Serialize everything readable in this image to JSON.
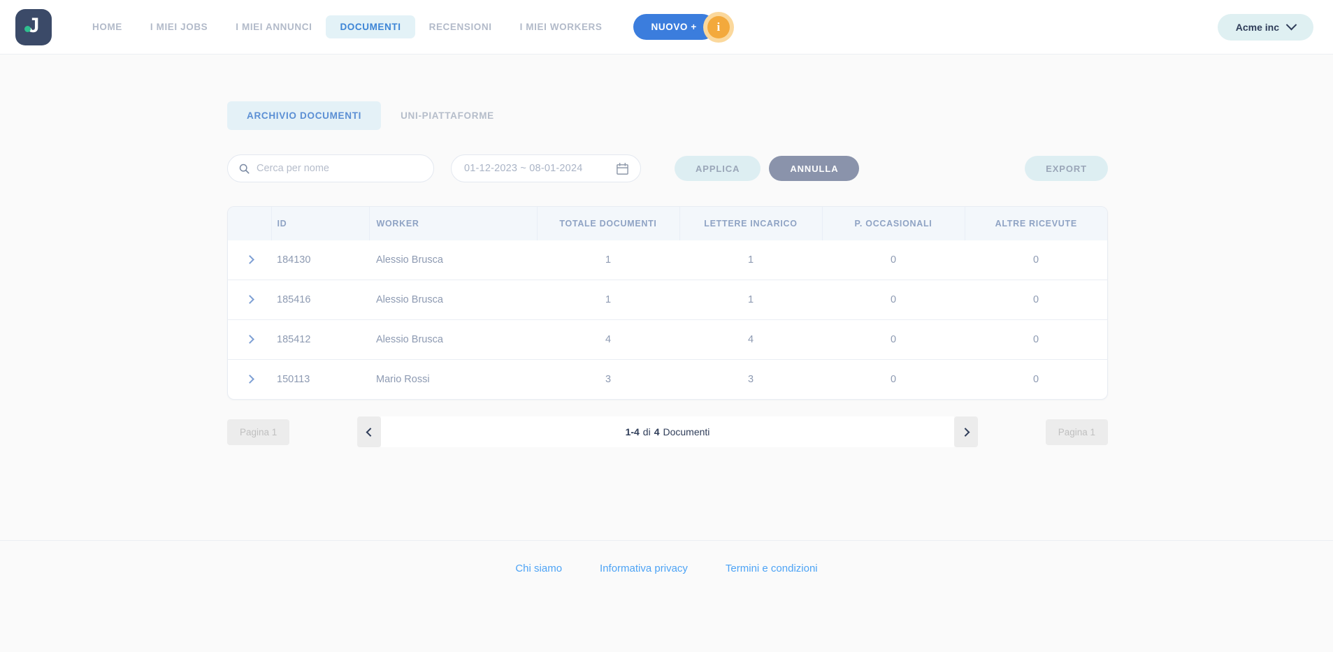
{
  "header": {
    "logo": {
      "letter": "J",
      "icon": "logo-j-mark"
    },
    "nav": [
      {
        "label": "HOME",
        "active": false
      },
      {
        "label": "I MIEI JOBS",
        "active": false
      },
      {
        "label": "I MIEI ANNUNCI",
        "active": false
      },
      {
        "label": "DOCUMENTI",
        "active": true
      },
      {
        "label": "RECENSIONI",
        "active": false
      },
      {
        "label": "I MIEI WORKERS",
        "active": false
      }
    ],
    "new_button": "NUOVO +",
    "info_badge": "i",
    "org": "Acme inc",
    "colors": {
      "accent_blue": "#3b7ddd",
      "active_tab_bg": "#e3f2f7",
      "badge_orange": "#f3a93c"
    }
  },
  "tabs": [
    {
      "label": "ARCHIVIO DOCUMENTI",
      "active": true
    },
    {
      "label": "UNI-PIATTAFORME",
      "active": false
    }
  ],
  "toolbar": {
    "search_placeholder": "Cerca per nome",
    "search_value": "",
    "date_range": "01-12-2023 ~ 08-01-2024",
    "apply_label": "APPLICA",
    "cancel_label": "ANNULLA",
    "export_label": "EXPORT"
  },
  "table": {
    "columns": [
      "ID",
      "WORKER",
      "TOTALE DOCUMENTI",
      "LETTERE INCARICO",
      "P. OCCASIONALI",
      "ALTRE RICEVUTE"
    ],
    "rows": [
      {
        "id": "184130",
        "worker": "Alessio Brusca",
        "totale_documenti": "1",
        "lettere_incarico": "1",
        "p_occasionali": "0",
        "altre_ricevute": "0"
      },
      {
        "id": "185416",
        "worker": "Alessio Brusca",
        "totale_documenti": "1",
        "lettere_incarico": "1",
        "p_occasionali": "0",
        "altre_ricevute": "0"
      },
      {
        "id": "185412",
        "worker": "Alessio Brusca",
        "totale_documenti": "4",
        "lettere_incarico": "4",
        "p_occasionali": "0",
        "altre_ricevute": "0"
      },
      {
        "id": "150113",
        "worker": "Mario Rossi",
        "totale_documenti": "3",
        "lettere_incarico": "3",
        "p_occasionali": "0",
        "altre_ricevute": "0"
      }
    ]
  },
  "pagination": {
    "left_label": "Pagina 1",
    "right_label": "Pagina 1",
    "range": "1-4",
    "di": "di",
    "total": "4",
    "unit": "Documenti"
  },
  "footer": {
    "links": [
      "Chi siamo",
      "Informativa privacy",
      "Termini e condizioni"
    ]
  }
}
